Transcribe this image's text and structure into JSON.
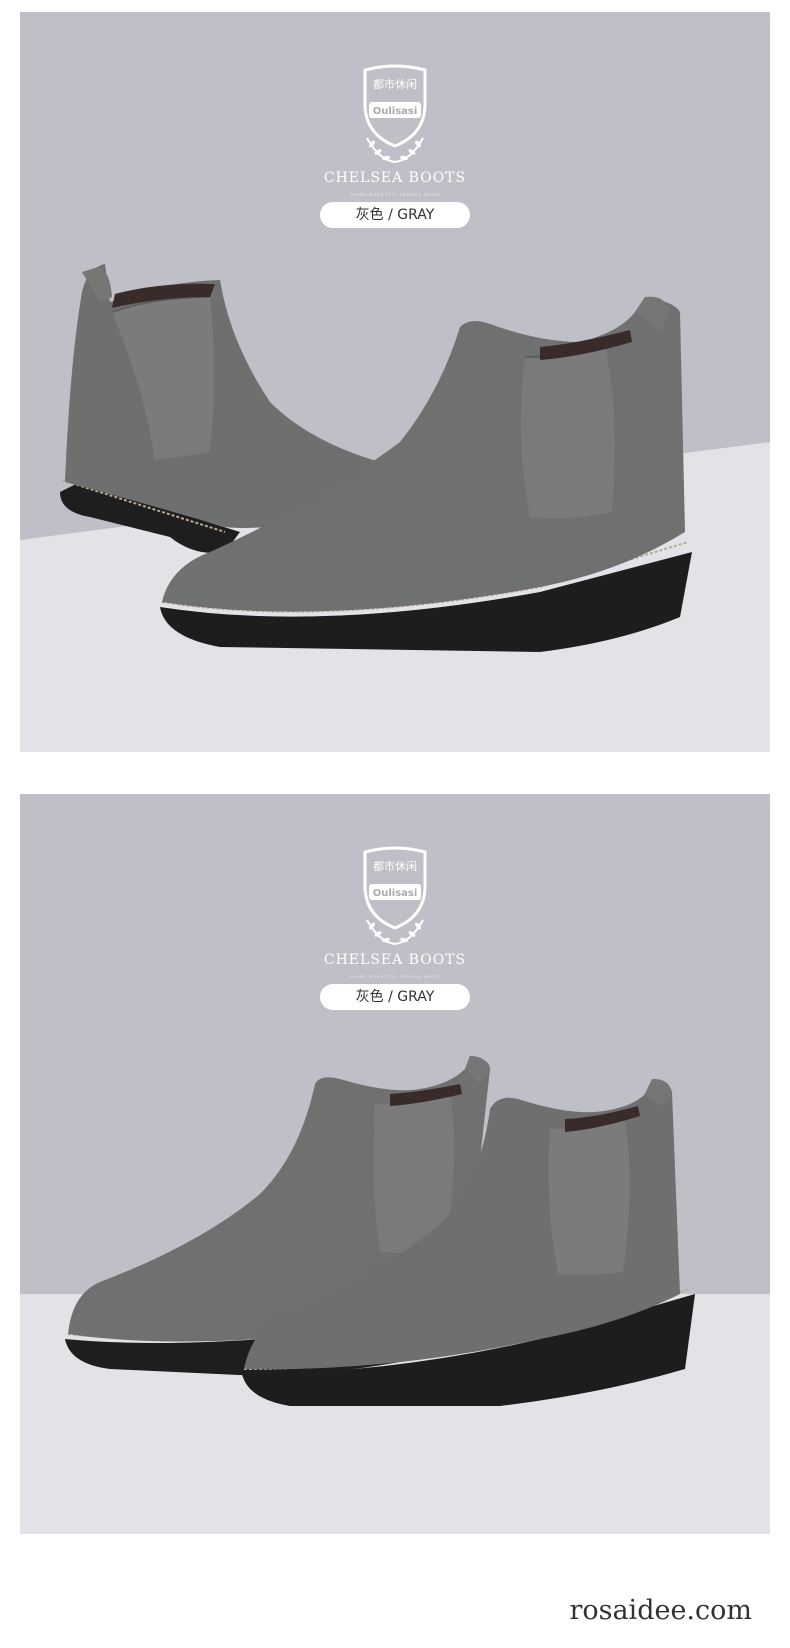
{
  "panels": [
    {
      "brand": {
        "badge_cn": "都市休闲",
        "badge_name": "Oulisasi",
        "title": "CHELSEA BOOTS",
        "tagline": "suede make this chelsea boots"
      },
      "color_label": "灰色 / GRAY"
    },
    {
      "brand": {
        "badge_cn": "都市休闲",
        "badge_name": "Oulisasi",
        "title": "CHELSEA BOOTS",
        "tagline": "suede make this chelsea boots"
      },
      "color_label": "灰色 / GRAY"
    }
  ],
  "watermark": "rosaidee.com",
  "colors": {
    "backdrop_top": "#bebec6",
    "backdrop_floor": "#e4e4e8",
    "suede": "#6f7070",
    "elastic": "#7a7a7b",
    "sole": "#1e1e1e",
    "welt": "#b9aa92"
  }
}
